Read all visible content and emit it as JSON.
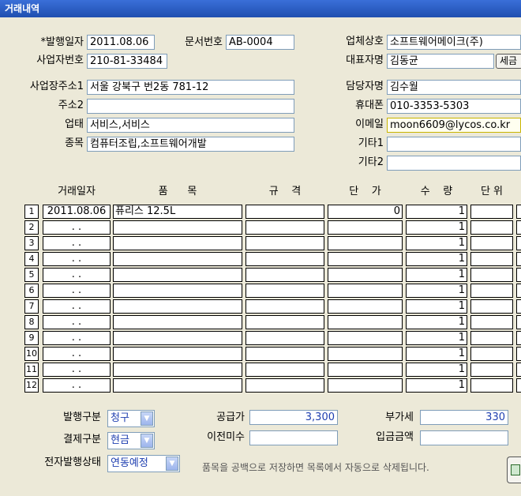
{
  "window": {
    "title": "거래내역"
  },
  "header": {
    "issue_date_label": "*발행일자",
    "issue_date": "2011.08.06",
    "doc_no_label": "문서번호",
    "doc_no": "AB-0004",
    "biz_no_label": "사업자번호",
    "biz_no": "210-81-33484",
    "company_label": "업체상호",
    "company": "소프트웨어메이크(주)",
    "ceo_label": "대표자명",
    "ceo": "김동균",
    "tax_button": "세금",
    "addr1_label": "사업장주소1",
    "addr1": "서울 강북구 번2동 781-12",
    "addr2_label": "주소2",
    "addr2": "",
    "biz_type_label": "업태",
    "biz_type": "서비스,서비스",
    "biz_item_label": "종목",
    "biz_item": "컴퓨터조립,소프트웨어개발",
    "manager_label": "담당자명",
    "manager": "김수월",
    "mobile_label": "휴대폰",
    "mobile": "010-3353-5303",
    "email_label": "이메일",
    "email": "moon6609@lycos.co.kr",
    "etc1_label": "기타1",
    "etc1": "",
    "etc2_label": "기타2",
    "etc2": ""
  },
  "table": {
    "headers": {
      "date": "거래일자",
      "item": "품      목",
      "spec": "규    격",
      "price": "단    가",
      "qty": "수    량",
      "unit": "단 위"
    },
    "rows": [
      {
        "no": "1",
        "date": "2011.08.06",
        "item": "퓨리스 12.5L",
        "spec": "",
        "price": "0",
        "qty": "1",
        "unit": ""
      },
      {
        "no": "2",
        "date": ".   .",
        "item": "",
        "spec": "",
        "price": "",
        "qty": "1",
        "unit": ""
      },
      {
        "no": "3",
        "date": ".   .",
        "item": "",
        "spec": "",
        "price": "",
        "qty": "1",
        "unit": ""
      },
      {
        "no": "4",
        "date": ".   .",
        "item": "",
        "spec": "",
        "price": "",
        "qty": "1",
        "unit": ""
      },
      {
        "no": "5",
        "date": ".   .",
        "item": "",
        "spec": "",
        "price": "",
        "qty": "1",
        "unit": ""
      },
      {
        "no": "6",
        "date": ".   .",
        "item": "",
        "spec": "",
        "price": "",
        "qty": "1",
        "unit": ""
      },
      {
        "no": "7",
        "date": ".   .",
        "item": "",
        "spec": "",
        "price": "",
        "qty": "1",
        "unit": ""
      },
      {
        "no": "8",
        "date": ".   .",
        "item": "",
        "spec": "",
        "price": "",
        "qty": "1",
        "unit": ""
      },
      {
        "no": "9",
        "date": ".   .",
        "item": "",
        "spec": "",
        "price": "",
        "qty": "1",
        "unit": ""
      },
      {
        "no": "10",
        "date": ".   .",
        "item": "",
        "spec": "",
        "price": "",
        "qty": "1",
        "unit": ""
      },
      {
        "no": "11",
        "date": ".   .",
        "item": "",
        "spec": "",
        "price": "",
        "qty": "1",
        "unit": ""
      },
      {
        "no": "12",
        "date": ".   .",
        "item": "",
        "spec": "",
        "price": "",
        "qty": "1",
        "unit": ""
      }
    ]
  },
  "footer": {
    "issue_type_label": "발행구분",
    "issue_type": "청구",
    "payment_type_label": "결제구분",
    "payment_type": "현금",
    "e_status_label": "전자발행상태",
    "e_status": "연동예정",
    "supply_label": "공급가",
    "supply": "3,300",
    "vat_label": "부가세",
    "vat": "330",
    "prev_unpaid_label": "이전미수",
    "prev_unpaid": "",
    "deposit_label": "입금금액",
    "deposit": "",
    "notice": "품목을 공백으로 저장하면 목록에서 자동으로 삭제됩니다."
  },
  "icons": {
    "dropdown": "chevron-down-icon",
    "save": "save-icon"
  }
}
